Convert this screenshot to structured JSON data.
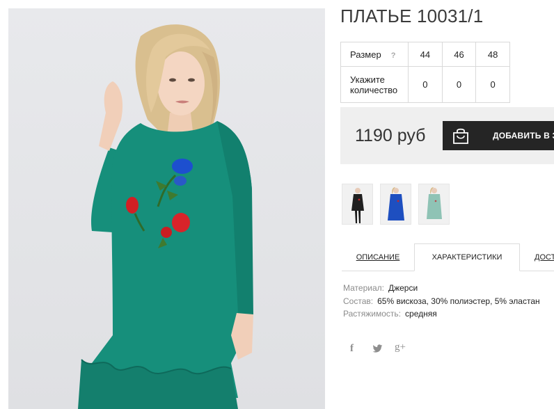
{
  "product": {
    "title": "ПЛАТЬЕ 10031/1",
    "main_image_icon": "green-dress-photo"
  },
  "sizes": {
    "label": "Размер",
    "help": "?",
    "quantity_label_line1": "Укажите",
    "quantity_label_line2": "количество",
    "items": [
      {
        "size": "44",
        "qty": "0"
      },
      {
        "size": "46",
        "qty": "0"
      },
      {
        "size": "48",
        "qty": "0"
      }
    ]
  },
  "purchase": {
    "price": "1190 руб",
    "button_label": "ДОБАВИТЬ В ЗА",
    "button_icon": "shopping-bag-icon"
  },
  "variants": [
    {
      "name": "black",
      "color": "#1f1f1f"
    },
    {
      "name": "blue",
      "color": "#1e4fc0"
    },
    {
      "name": "mint",
      "color": "#8fc3b5"
    }
  ],
  "tabs": [
    {
      "label": "ОПИСАНИЕ",
      "active": false
    },
    {
      "label": "ХАРАКТЕРИСТИКИ",
      "active": true
    },
    {
      "label": "ДОСТ",
      "active": false
    }
  ],
  "characteristics": [
    {
      "key": "Материал:",
      "value": "Джерси"
    },
    {
      "key": "Состав:",
      "value": "65% вискоза, 30% полиэстер, 5% эластан"
    },
    {
      "key": "Растяжимость:",
      "value": "средняя"
    }
  ],
  "social": {
    "facebook": "f",
    "twitter": "twitter-bird-icon",
    "google_plus": "g+"
  },
  "colors": {
    "dress_main": "#168f7b",
    "button_bg": "#252525",
    "price_bar_bg": "#efefef"
  }
}
